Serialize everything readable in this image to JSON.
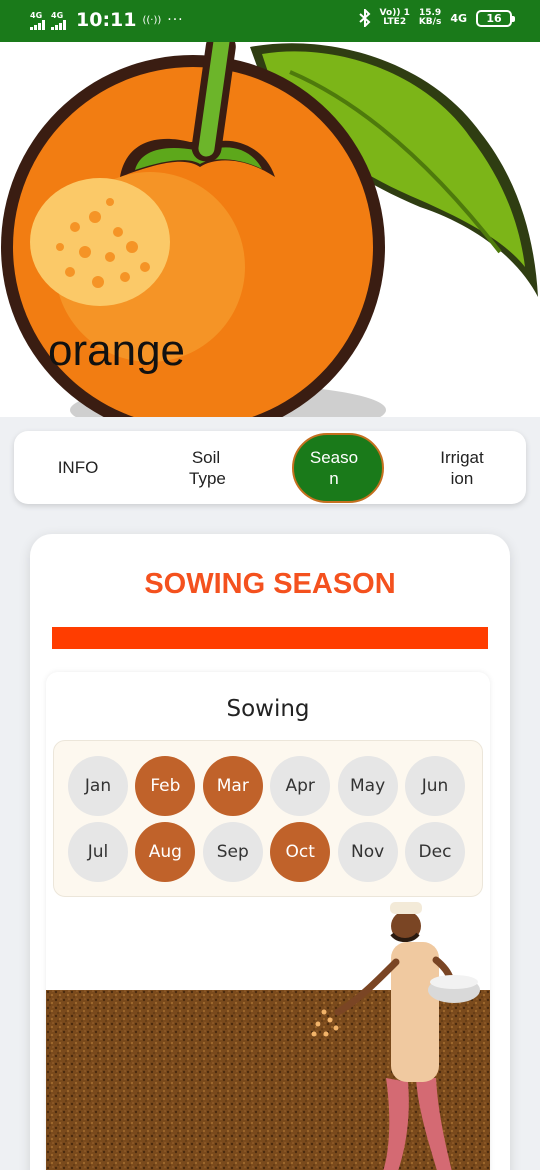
{
  "status_bar": {
    "sim1": "4G",
    "sim2": "4G",
    "time": "10:11",
    "hotspot": "((·))",
    "more": "···",
    "bluetooth": "bluetooth-icon",
    "volte_top": "Vo)) 1",
    "volte_bottom": "LTE2",
    "speed_value": "15.9",
    "speed_unit": "KB/s",
    "net": "4G",
    "battery": "16"
  },
  "hero": {
    "title": "orange"
  },
  "tabs": [
    {
      "label": "INFO",
      "active": false
    },
    {
      "label": "Soil Type",
      "active": false
    },
    {
      "label": "Season",
      "active": true
    },
    {
      "label": "Irrigation",
      "active": false
    }
  ],
  "season_card": {
    "title": "SOWING SEASON",
    "accent_color": "#ff3d00",
    "sowing": {
      "title": "Sowing",
      "months": [
        {
          "name": "Jan",
          "selected": false
        },
        {
          "name": "Feb",
          "selected": true
        },
        {
          "name": "Mar",
          "selected": true
        },
        {
          "name": "Apr",
          "selected": false
        },
        {
          "name": "May",
          "selected": false
        },
        {
          "name": "Jun",
          "selected": false
        },
        {
          "name": "Jul",
          "selected": false
        },
        {
          "name": "Aug",
          "selected": true
        },
        {
          "name": "Sep",
          "selected": false
        },
        {
          "name": "Oct",
          "selected": true
        },
        {
          "name": "Nov",
          "selected": false
        },
        {
          "name": "Dec",
          "selected": false
        }
      ]
    }
  },
  "colors": {
    "status_bar": "#1a7a1a",
    "active_tab": "#1a7a1a",
    "selected_month": "#c0622a",
    "title": "#f4511e"
  }
}
